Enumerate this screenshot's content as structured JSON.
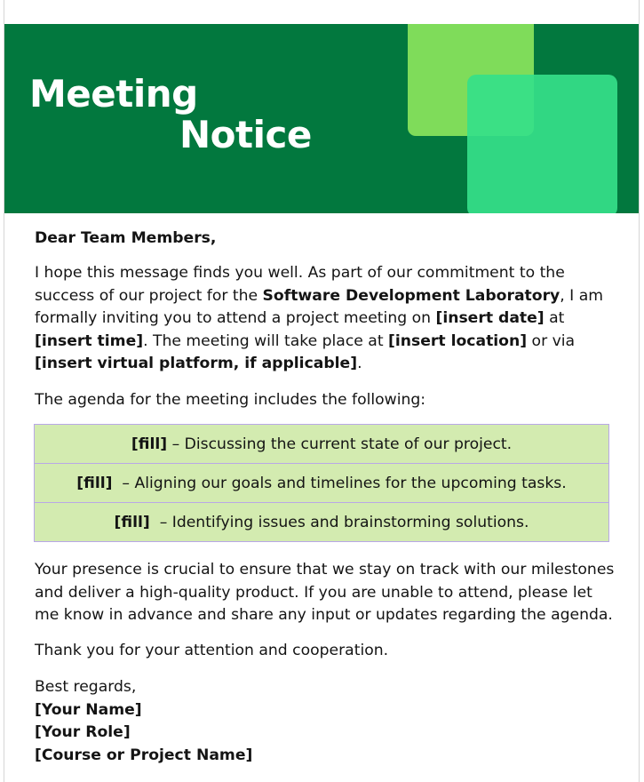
{
  "banner": {
    "title_line1": "Meeting",
    "title_line2": "Notice",
    "colors": {
      "background": "#02783e",
      "square_light": "#7fdc5a",
      "square_mint": "#35df89"
    }
  },
  "letter": {
    "greeting": "Dear Team Members,",
    "para1": {
      "t1": "I hope this message finds you well. As part of our commitment to the success of our project for the ",
      "lab": "Software Development Laboratory",
      "t2": ", I am formally inviting you to attend a project meeting on ",
      "date": "[insert date]",
      "t3": " at ",
      "time": "[insert time]",
      "t4": ". The meeting will take place at ",
      "location": "[insert location]",
      "t5": " or via ",
      "virtual": "[insert virtual platform, if applicable]",
      "t6": "."
    },
    "agenda_intro": "The agenda for the meeting includes the following:",
    "agenda": [
      {
        "tag": "[fill]",
        "text": " – Discussing the current state of our project."
      },
      {
        "tag": "[fill]",
        "text": "  – Aligning our goals and timelines for the upcoming tasks."
      },
      {
        "tag": "[fill]",
        "text": "  – Identifying issues and brainstorming solutions."
      }
    ],
    "para2": "Your presence is crucial to ensure that we stay on track with our milestones and deliver a high-quality product. If you are unable to attend, please let me know in advance and share any input or updates regarding the agenda.",
    "thanks": "Thank you for your attention and cooperation.",
    "closing": "Best regards,",
    "name": "[Your Name]",
    "role": "[Your Role]",
    "course": "[Course or Project Name]"
  },
  "colors": {
    "agenda_fill": "#d3ebb0",
    "agenda_border": "#b9a8e6"
  }
}
